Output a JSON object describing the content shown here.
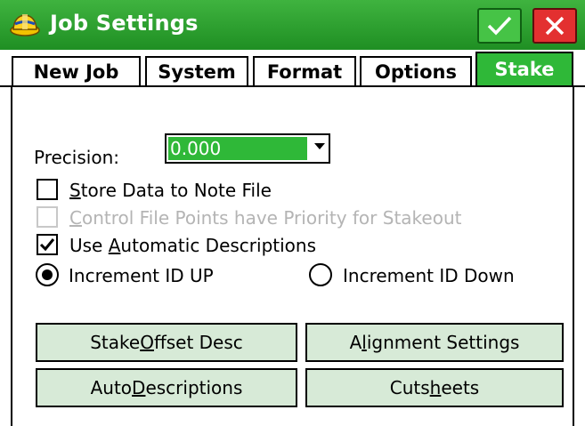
{
  "window": {
    "title": "Job Settings",
    "ok_icon": "checkmark-icon",
    "close_icon": "close-icon"
  },
  "tabs": [
    {
      "label": "New Job",
      "active": false
    },
    {
      "label": "System",
      "active": false
    },
    {
      "label": "Format",
      "active": false
    },
    {
      "label": "Options",
      "active": false
    },
    {
      "label": "Stake",
      "active": true
    }
  ],
  "precision": {
    "label": "Precision:",
    "value": "0.000"
  },
  "checkboxes": {
    "store_data": {
      "pre": "",
      "u": "S",
      "post": "tore Data to Note File",
      "checked": false,
      "enabled": true
    },
    "control_priority": {
      "pre": "",
      "u": "C",
      "post": "ontrol File Points have Priority for Stakeout",
      "checked": false,
      "enabled": false
    },
    "auto_desc": {
      "pre": "Use ",
      "u": "A",
      "post": "utomatic Descriptions",
      "checked": true,
      "enabled": true
    }
  },
  "radios": {
    "up": {
      "label": "Increment ID UP",
      "selected": true
    },
    "down": {
      "label": "Increment ID Down",
      "selected": false
    }
  },
  "buttons": {
    "stake_offset": {
      "pre": "Stake ",
      "u": "O",
      "post": "ffset Desc"
    },
    "alignment": {
      "pre": "A",
      "u": "l",
      "post": "ignment Settings"
    },
    "auto_desc": {
      "pre": "Auto ",
      "u": "D",
      "post": "escriptions"
    },
    "cutsheets": {
      "pre": "Cuts",
      "u": "h",
      "post": "eets"
    }
  },
  "colors": {
    "accent_green": "#2fb838",
    "button_fill": "#d7ead7",
    "close_red": "#e33030"
  }
}
